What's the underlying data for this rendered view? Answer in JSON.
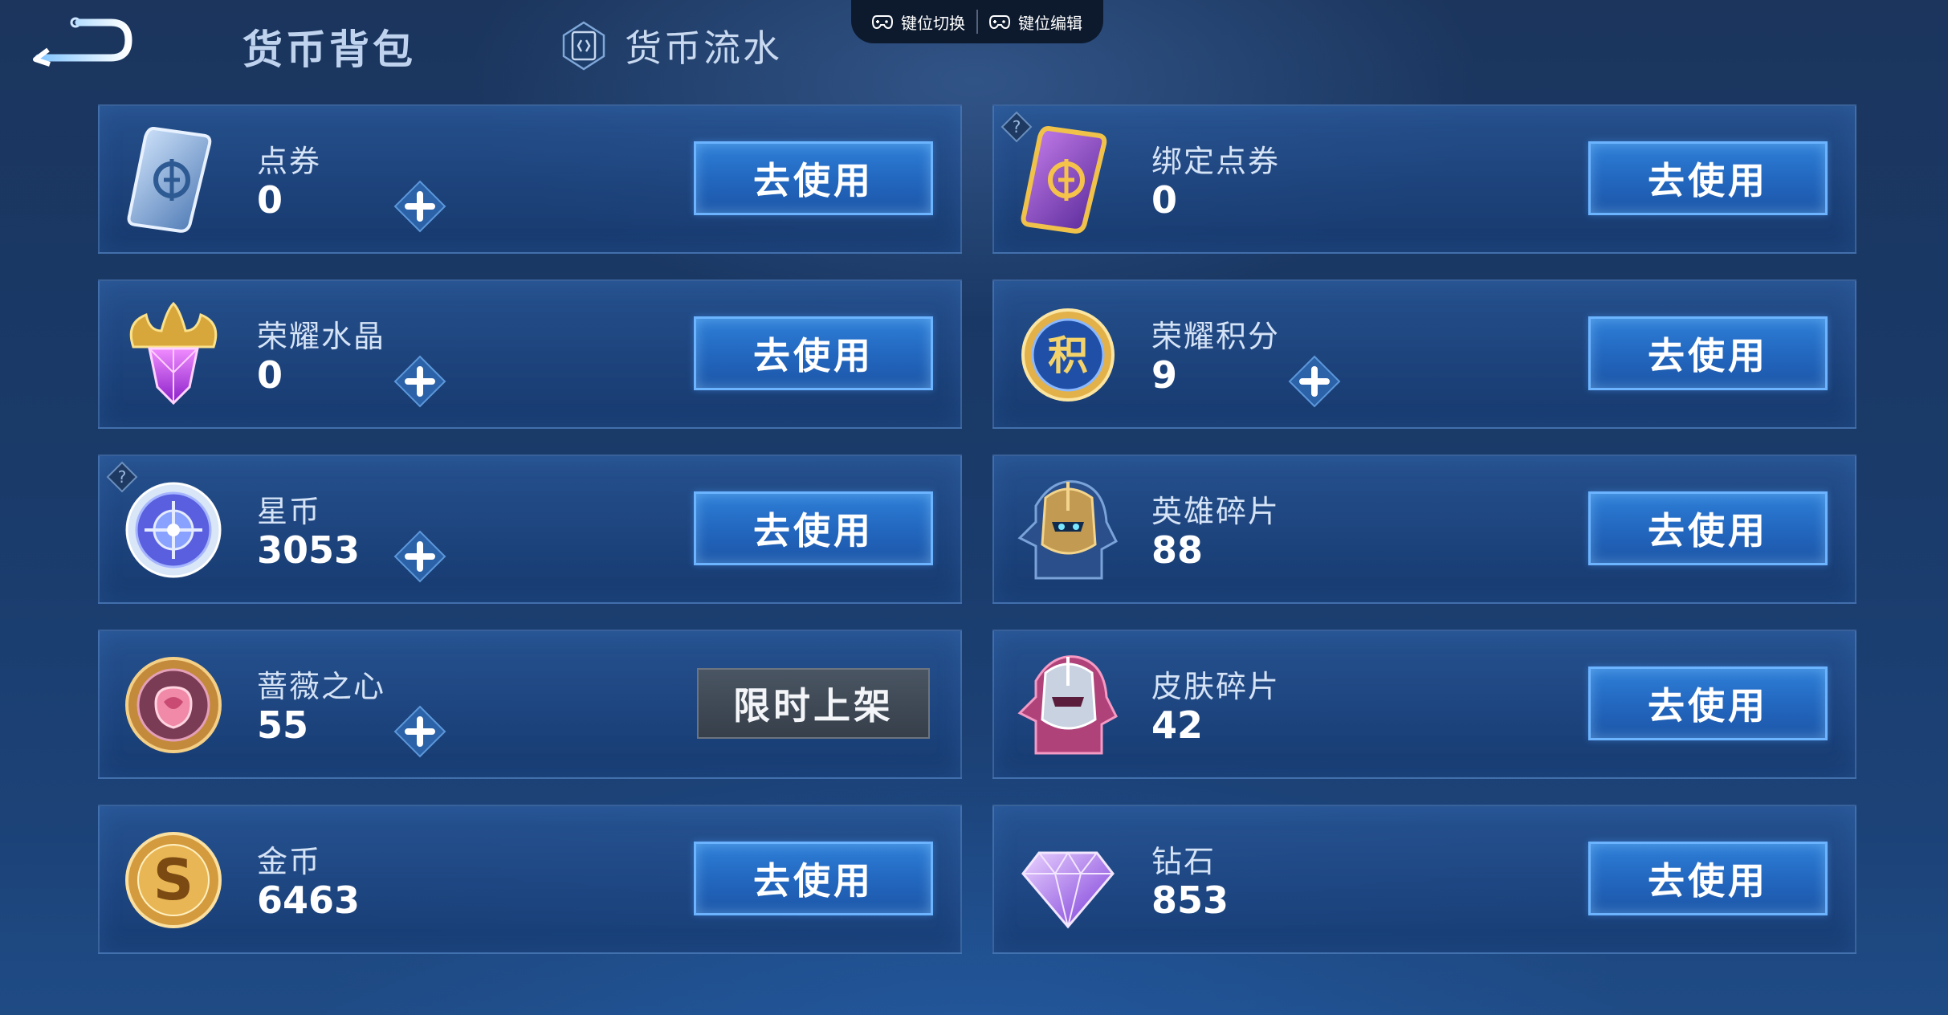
{
  "header": {
    "tab_wallet": "货币背包",
    "tab_flow": "货币流水",
    "key_switch": "键位切换",
    "key_edit": "键位编辑"
  },
  "colors": {
    "accent_button": "#2368c0",
    "button_border": "#6cb4ff",
    "disabled_button": "#3f4854"
  },
  "currencies": [
    {
      "name": "点券",
      "amount": "0",
      "has_plus": true,
      "help": false,
      "action": "去使用",
      "icon": "voucher-card-icon"
    },
    {
      "name": "绑定点券",
      "amount": "0",
      "has_plus": false,
      "help": true,
      "action": "去使用",
      "icon": "bound-voucher-card-icon"
    },
    {
      "name": "荣耀水晶",
      "amount": "0",
      "has_plus": true,
      "help": false,
      "action": "去使用",
      "icon": "glory-crystal-icon"
    },
    {
      "name": "荣耀积分",
      "amount": "9",
      "has_plus": true,
      "help": false,
      "action": "去使用",
      "icon": "glory-points-coin-icon"
    },
    {
      "name": "星币",
      "amount": "3053",
      "has_plus": true,
      "help": true,
      "action": "去使用",
      "icon": "star-coin-icon"
    },
    {
      "name": "英雄碎片",
      "amount": "88",
      "has_plus": false,
      "help": false,
      "action": "去使用",
      "icon": "hero-fragment-helmet-icon"
    },
    {
      "name": "蔷薇之心",
      "amount": "55",
      "has_plus": true,
      "help": false,
      "action": "限时上架",
      "icon": "rose-heart-coin-icon"
    },
    {
      "name": "皮肤碎片",
      "amount": "42",
      "has_plus": false,
      "help": false,
      "action": "去使用",
      "icon": "skin-fragment-helmet-icon"
    },
    {
      "name": "金币",
      "amount": "6463",
      "has_plus": false,
      "help": false,
      "action": "去使用",
      "icon": "gold-coin-icon"
    },
    {
      "name": "钻石",
      "amount": "853",
      "has_plus": false,
      "help": false,
      "action": "去使用",
      "icon": "diamond-icon"
    }
  ]
}
